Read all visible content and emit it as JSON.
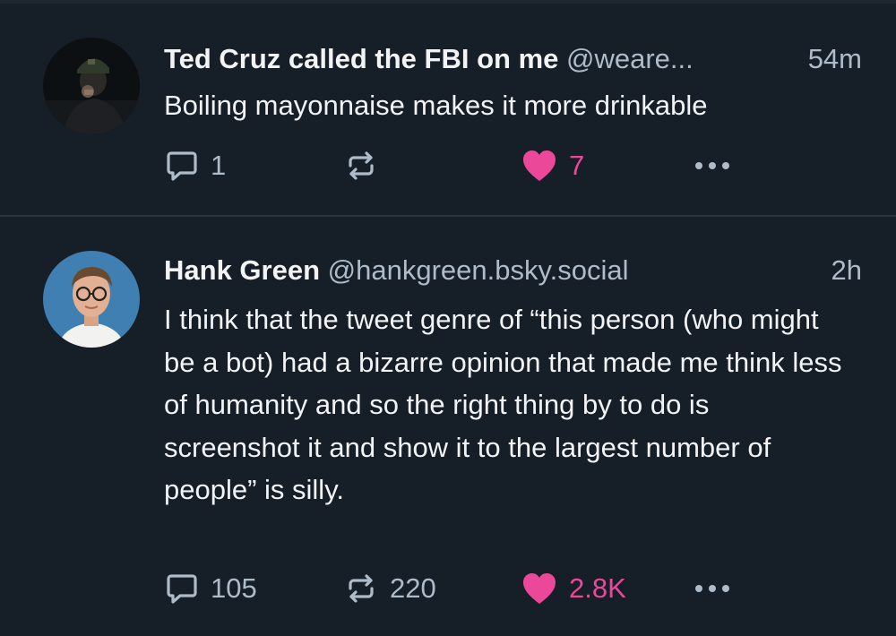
{
  "posts": [
    {
      "author": "Ted Cruz called the FBI on me",
      "handle": "@weare...",
      "time": "54m",
      "text": "Boiling mayonnaise makes it more drinkable",
      "replies": "1",
      "reposts": "",
      "likes": "7",
      "liked": true
    },
    {
      "author": "Hank Green",
      "handle": "@hankgreen.bsky.social",
      "time": "2h",
      "text": "I think that the tweet genre of “this person (who might be a bot) had a bizarre opinion that made me think less of humanity and so the right thing by to do is screenshot it and show it to the largest number of people” is silly.",
      "replies": "105",
      "reposts": "220",
      "likes": "2.8K",
      "liked": true
    }
  ],
  "colors": {
    "background": "#161e27",
    "text": "#f1f3f5",
    "muted": "#aebbc9",
    "like": "#ec4899",
    "divider": "#2a3541"
  },
  "icons": {
    "reply": "speech-bubble-icon",
    "repost": "repost-arrows-icon",
    "like": "heart-icon",
    "more": "ellipsis-icon"
  }
}
